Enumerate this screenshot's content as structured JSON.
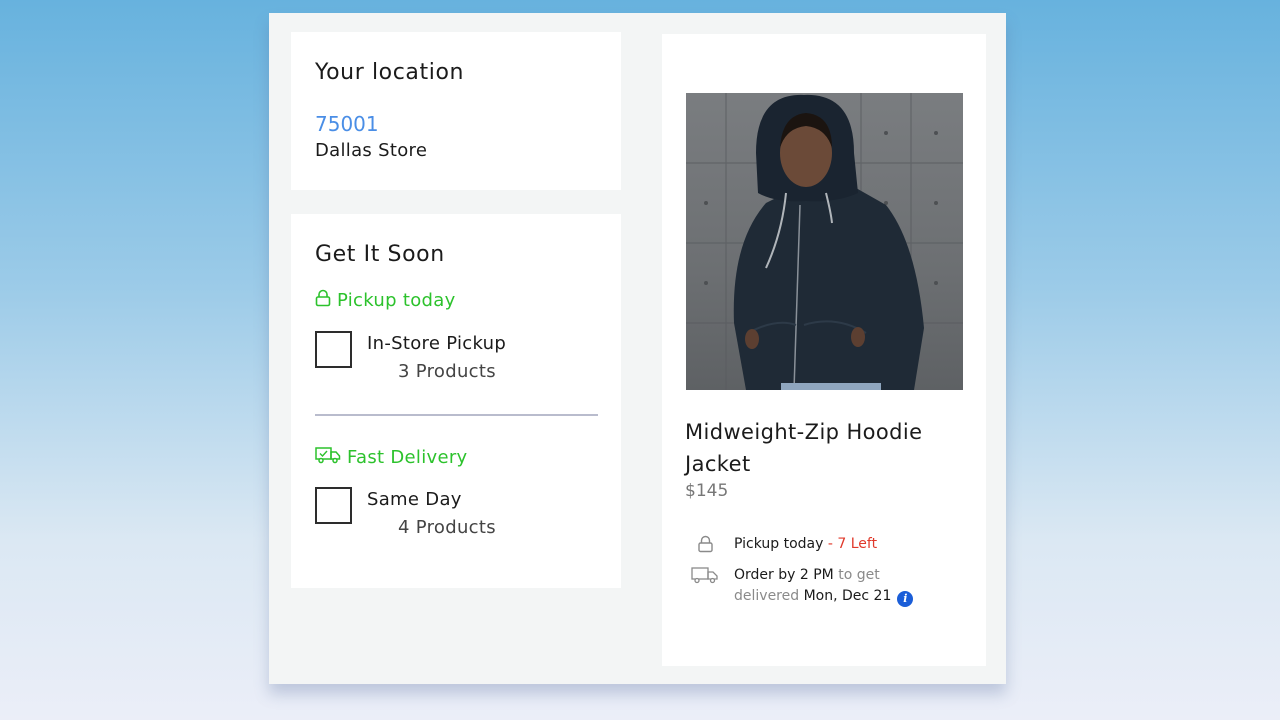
{
  "location": {
    "title": "Your location",
    "zip": "75001",
    "store": "Dallas Store"
  },
  "get_it_soon": {
    "title": "Get It Soon",
    "pickup": {
      "label": "Pickup today",
      "option_title": "In-Store Pickup",
      "option_count": "3 Products",
      "icon": "lock-icon"
    },
    "delivery": {
      "label": "Fast Delivery",
      "option_title": "Same Day",
      "option_count": "4 Products",
      "icon": "truck-icon"
    }
  },
  "product": {
    "name": "Midweight-Zip Hoodie Jacket",
    "price": "$145",
    "pickup_text": "Pickup today",
    "pickup_sep": " - ",
    "pickup_stock": "7 Left",
    "order_by": "Order by 2 PM",
    "to_get": " to get",
    "delivered": "delivered",
    "delivery_date": " Mon, Dec 21",
    "info_symbol": "i"
  },
  "colors": {
    "accent_green": "#2cc22c",
    "link_blue": "#4a8ee6",
    "stock_red": "#e0392b",
    "info_blue": "#1b5ed8"
  }
}
